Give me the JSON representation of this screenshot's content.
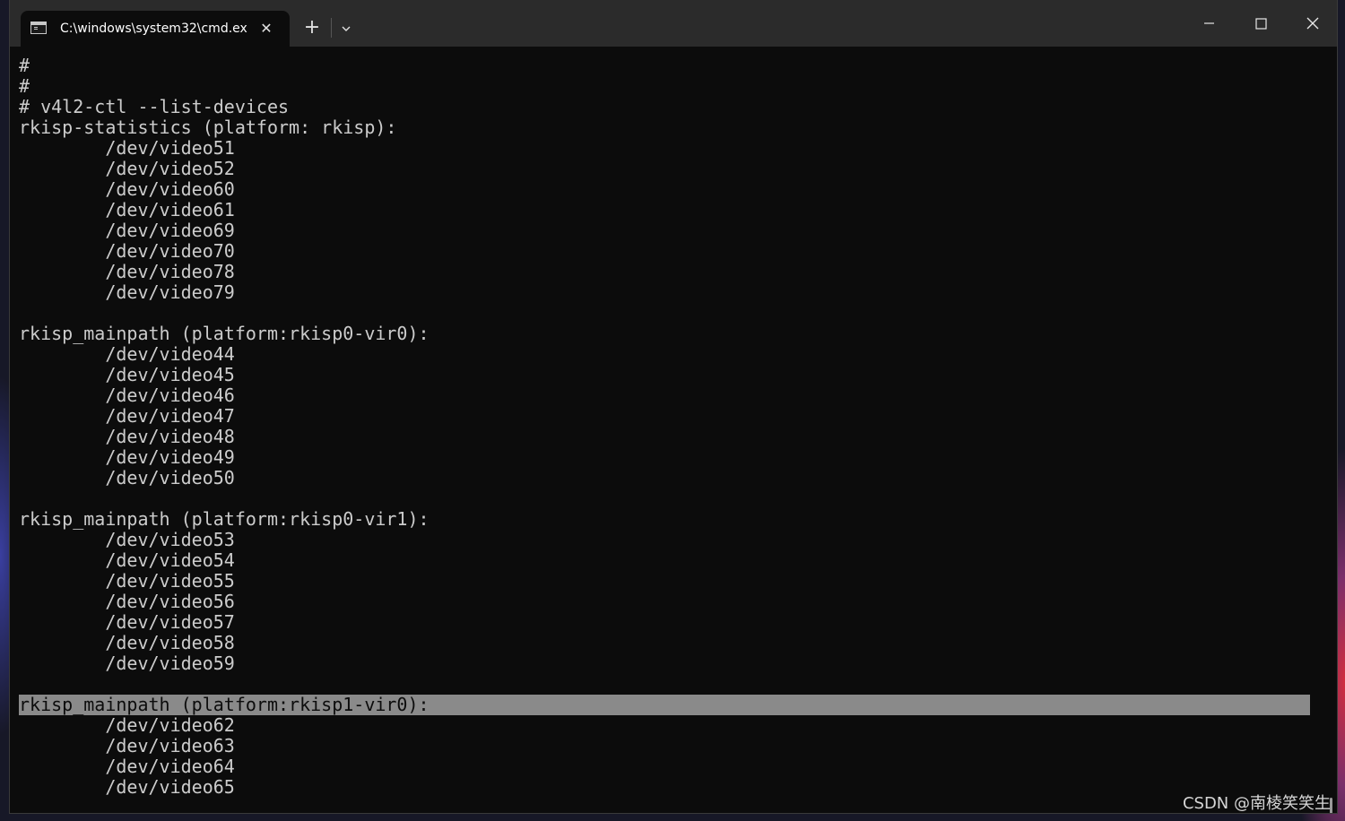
{
  "window": {
    "tab_title": "C:\\windows\\system32\\cmd.ex",
    "tab_icon": "terminal-icon",
    "close_tab_icon": "close-icon",
    "new_tab_icon": "plus-icon",
    "dropdown_icon": "chevron-down-icon",
    "minimize_icon": "minimize-icon",
    "maximize_icon": "maximize-icon",
    "close_window_icon": "close-icon"
  },
  "terminal": {
    "background": "#0c0c0c",
    "foreground": "#cccccc",
    "selection": "#8a8a8a",
    "lines": [
      "#",
      "#",
      "# v4l2-ctl --list-devices",
      "rkisp-statistics (platform: rkisp):",
      "        /dev/video51",
      "        /dev/video52",
      "        /dev/video60",
      "        /dev/video61",
      "        /dev/video69",
      "        /dev/video70",
      "        /dev/video78",
      "        /dev/video79",
      "",
      "rkisp_mainpath (platform:rkisp0-vir0):",
      "        /dev/video44",
      "        /dev/video45",
      "        /dev/video46",
      "        /dev/video47",
      "        /dev/video48",
      "        /dev/video49",
      "        /dev/video50",
      "",
      "rkisp_mainpath (platform:rkisp0-vir1):",
      "        /dev/video53",
      "        /dev/video54",
      "        /dev/video55",
      "        /dev/video56",
      "        /dev/video57",
      "        /dev/video58",
      "        /dev/video59",
      "",
      "rkisp_mainpath (platform:rkisp1-vir0):",
      "        /dev/video62",
      "        /dev/video63",
      "        /dev/video64",
      "        /dev/video65"
    ],
    "selected_line_index": 31
  },
  "watermark": "CSDN @南棱笑笑生"
}
